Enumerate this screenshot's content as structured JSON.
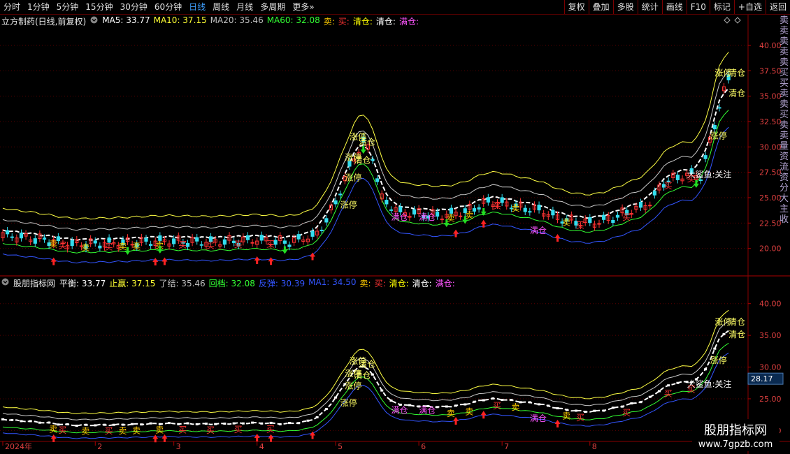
{
  "periods": [
    {
      "label": "分时"
    },
    {
      "label": "1分钟"
    },
    {
      "label": "5分钟"
    },
    {
      "label": "15分钟"
    },
    {
      "label": "30分钟"
    },
    {
      "label": "60分钟"
    },
    {
      "label": "日线",
      "active": true
    },
    {
      "label": "周线"
    },
    {
      "label": "月线"
    },
    {
      "label": "多周期"
    },
    {
      "label": "更多»"
    }
  ],
  "toolbar_right": [
    "复权",
    "叠加",
    "多股",
    "统计",
    "画线",
    "F10",
    "标记",
    "+自选",
    "返回"
  ],
  "main_legend": {
    "stock_title": "立方制药(日线,前复权)",
    "items": [
      {
        "text": "MA5: 33.77",
        "color": "#ffffff"
      },
      {
        "text": "MA10: 37.15",
        "color": "#ffff33"
      },
      {
        "text": "MA20: 35.46",
        "color": "#bfbfbf"
      },
      {
        "text": "MA60: 32.08",
        "color": "#33ff33"
      },
      {
        "text": "卖:",
        "color": "#ffcc00"
      },
      {
        "text": "买:",
        "color": "#ff3333"
      },
      {
        "text": "清仓:",
        "color": "#ffff00"
      },
      {
        "text": "清仓:",
        "color": "#ffffff"
      },
      {
        "text": "满仓:",
        "color": "#ff55ff"
      }
    ]
  },
  "sub_legend": {
    "indicator_title": "股朋指标网",
    "items": [
      {
        "text": "平衡: 33.77",
        "color": "#ffffff"
      },
      {
        "text": "止赢: 37.15",
        "color": "#ffff33"
      },
      {
        "text": "了结: 35.46",
        "color": "#bfbfbf"
      },
      {
        "text": "回档: 32.08",
        "color": "#33ff33"
      },
      {
        "text": "反弹: 30.39",
        "color": "#3355ff"
      },
      {
        "text": "MA1: 34.50",
        "color": "#3355ff"
      },
      {
        "text": "卖:",
        "color": "#ffcc00"
      },
      {
        "text": "买:",
        "color": "#ff3333"
      },
      {
        "text": "清仓:",
        "color": "#ffff00"
      },
      {
        "text": "清仓:",
        "color": "#ffffff"
      },
      {
        "text": "满仓:",
        "color": "#ff55ff"
      }
    ]
  },
  "side_labels": "卖卖卖卖卖买买卖卖买卖卖量资流资分大主收",
  "watermark": "股朋指标网\nwww.7gpzb.com",
  "price_tag": "28.17",
  "chart_data": [
    {
      "type": "candlestick",
      "title": "立方制药(日线,前复权)",
      "y_ticks": [
        20.0,
        22.5,
        25.0,
        27.5,
        30.0,
        32.5,
        35.0,
        37.5,
        40.0
      ],
      "ylim": [
        17.5,
        42.0
      ],
      "series_names": [
        "MA5",
        "MA10",
        "MA20",
        "MA60"
      ],
      "price_path": [
        [
          0,
          21.3
        ],
        [
          8,
          20.9
        ],
        [
          15,
          20.4
        ],
        [
          25,
          20.5
        ],
        [
          35,
          20.7
        ],
        [
          45,
          20.6
        ],
        [
          55,
          20.8
        ],
        [
          62,
          20.6
        ],
        [
          68,
          21.3
        ],
        [
          72,
          24.5
        ],
        [
          75,
          28.0
        ],
        [
          78,
          30.5
        ],
        [
          80,
          29.0
        ],
        [
          82,
          24.8
        ],
        [
          86,
          23.5
        ],
        [
          90,
          23.4
        ],
        [
          95,
          23.2
        ],
        [
          100,
          23.6
        ],
        [
          105,
          24.6
        ],
        [
          110,
          24.3
        ],
        [
          112,
          24.0
        ],
        [
          116,
          23.8
        ],
        [
          120,
          23.0
        ],
        [
          124,
          22.6
        ],
        [
          128,
          22.5
        ],
        [
          132,
          23.0
        ],
        [
          135,
          23.6
        ],
        [
          138,
          24.0
        ],
        [
          140,
          24.5
        ],
        [
          143,
          26.5
        ],
        [
          146,
          27.0
        ],
        [
          149,
          27.3
        ],
        [
          151,
          27.0
        ],
        [
          153,
          30.5
        ],
        [
          155,
          34.0
        ],
        [
          157,
          36.8
        ],
        [
          158,
          34.5
        ]
      ],
      "annotations": [
        {
          "text": "涨停",
          "x": 73,
          "y": 24.0
        },
        {
          "text": "涨停",
          "x": 74,
          "y": 26.7
        },
        {
          "text": "涨停",
          "x": 74,
          "y": 28.7
        },
        {
          "text": "涨停",
          "x": 75,
          "y": 30.7
        },
        {
          "text": "清仓",
          "x": 77,
          "y": 30.2
        },
        {
          "text": "清仓",
          "x": 76,
          "y": 28.4
        },
        {
          "text": "涨停",
          "x": 153,
          "y": 30.8
        },
        {
          "text": "涨停",
          "x": 154,
          "y": 37.0
        },
        {
          "text": "清仓",
          "x": 157,
          "y": 37.0
        },
        {
          "text": "清仓",
          "x": 157,
          "y": 35.0
        },
        {
          "text": "满仓",
          "x": 84,
          "y": 22.8
        },
        {
          "text": "满仓",
          "x": 90,
          "y": 22.8
        },
        {
          "text": "满仓",
          "x": 114,
          "y": 21.5
        },
        {
          "text": "大鲨鱼:",
          "x": 148,
          "y": 27.0
        },
        {
          "text": "关注",
          "x": 154,
          "y": 27.0
        }
      ]
    },
    {
      "type": "line",
      "title": "股朋指标网",
      "y_ticks": [
        20.0,
        25.0,
        30.0,
        35.0,
        40.0
      ],
      "ylim": [
        18.5,
        42.5
      ],
      "series_names": [
        "平衡",
        "止赢",
        "了结",
        "回档",
        "反弹",
        "MA1"
      ],
      "x_labels": [
        "2024年",
        "2",
        "3",
        "4",
        "5",
        "6",
        "7",
        "8"
      ]
    }
  ]
}
